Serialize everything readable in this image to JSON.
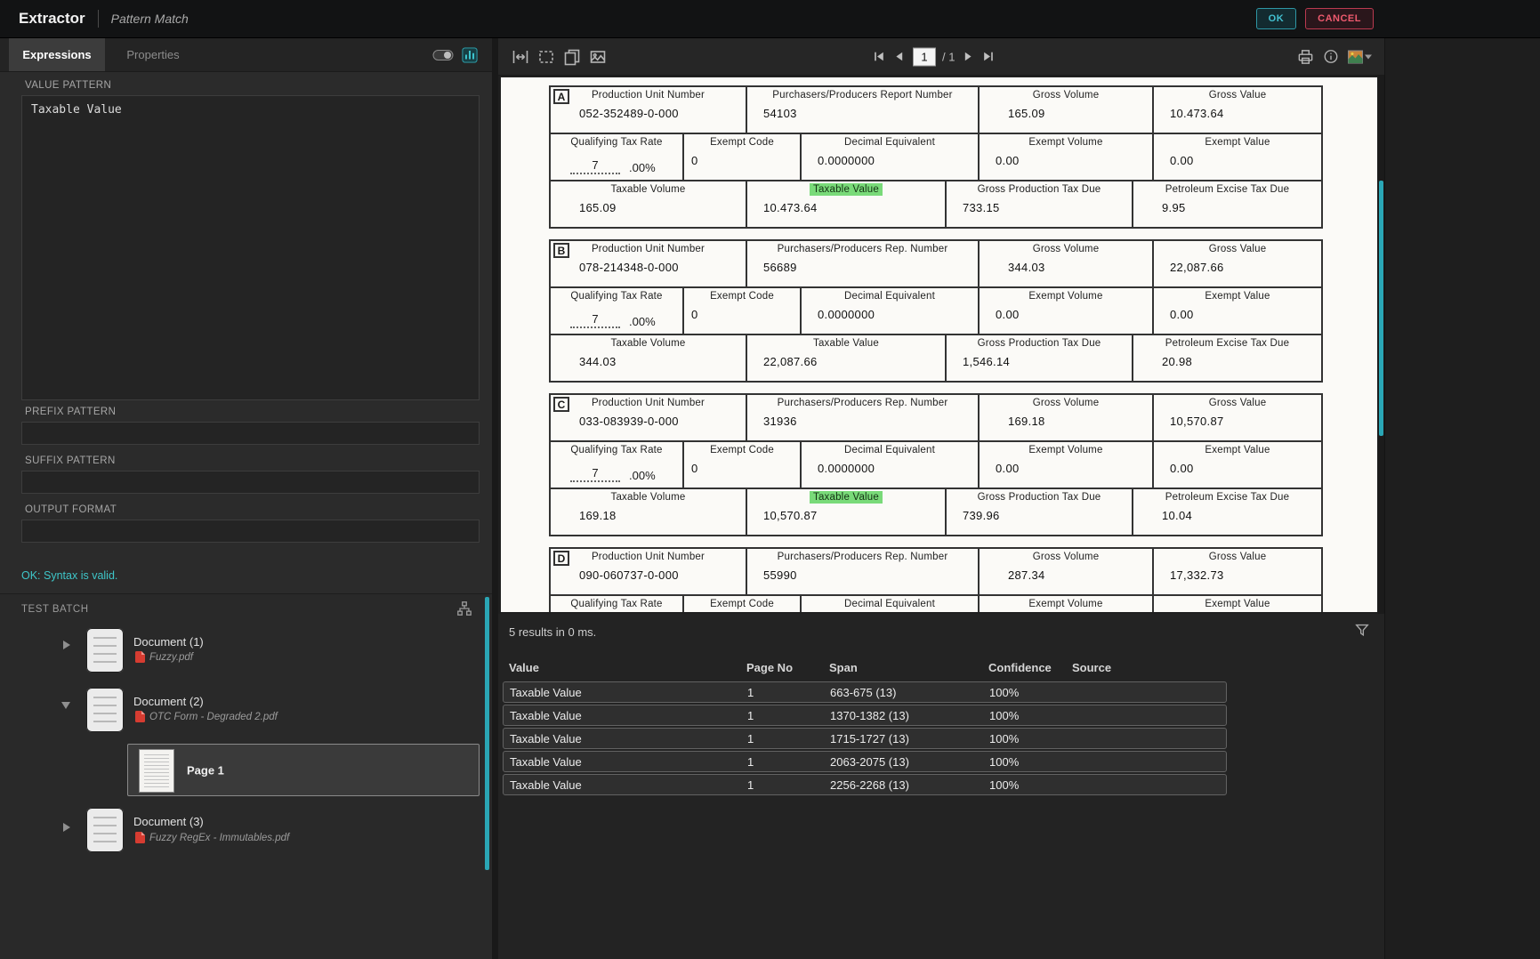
{
  "titlebar": {
    "title": "Extractor",
    "subtitle": "Pattern Match",
    "ok": "OK",
    "cancel": "CANCEL"
  },
  "panel": {
    "tab_expressions": "Expressions",
    "tab_properties": "Properties",
    "value_pattern_label": "VALUE PATTERN",
    "value_pattern_text": "Taxable Value",
    "prefix_pattern_label": "PREFIX PATTERN",
    "prefix_pattern_value": "",
    "suffix_pattern_label": "SUFFIX PATTERN",
    "suffix_pattern_value": "",
    "output_format_label": "OUTPUT FORMAT",
    "output_format_value": "",
    "status": "OK: Syntax is valid.",
    "test_batch_label": "TEST BATCH",
    "documents": [
      {
        "name": "Document (1)",
        "file": "Fuzzy.pdf"
      },
      {
        "name": "Document (2)",
        "file": "OTC Form - Degraded 2.pdf",
        "page": "Page 1"
      },
      {
        "name": "Document (3)",
        "file": "Fuzzy RegEx - Immutables.pdf"
      }
    ]
  },
  "viewer": {
    "page_value": "1",
    "page_total": "/ 1"
  },
  "form": {
    "sections": [
      {
        "letter": "A",
        "r1l": [
          "Production Unit Number",
          "Purchasers/Producers Report Number",
          "Gross Volume",
          "Gross Value"
        ],
        "r1v": [
          "052-352489-0-000",
          "54103",
          "165.09",
          "10.473.64"
        ],
        "r2l": [
          "Qualifying Tax Rate",
          "Exempt Code",
          "Decimal Equivalent",
          "Exempt Volume",
          "Exempt Value"
        ],
        "rate": "7",
        "rate_pct": ".00%",
        "r2v": [
          "0",
          "0.0000000",
          "0.00",
          "0.00"
        ],
        "r3l": [
          "Taxable Volume",
          "Taxable Value",
          "Gross Production Tax Due",
          "Petroleum Excise Tax Due"
        ],
        "r3v": [
          "165.09",
          "10.473.64",
          "733.15",
          "9.95"
        ],
        "taxable_value_highlighted": true
      },
      {
        "letter": "B",
        "r1l": [
          "Production Unit Number",
          "Purchasers/Producers Rep. Number",
          "Gross Volume",
          "Gross Value"
        ],
        "r1v": [
          "078-214348-0-000",
          "56689",
          "344.03",
          "22,087.66"
        ],
        "r2l": [
          "Qualifying Tax Rate",
          "Exempt Code",
          "Decimal Equivalent",
          "Exempt Volume",
          "Exempt Value"
        ],
        "rate": "7",
        "rate_pct": ".00%",
        "r2v": [
          "0",
          "0.0000000",
          "0.00",
          "0.00"
        ],
        "r3l": [
          "Taxable Volume",
          "Taxable Value",
          "Gross Production Tax Due",
          "Petroleum Excise Tax Due"
        ],
        "r3v": [
          "344.03",
          "22,087.66",
          "1,546.14",
          "20.98"
        ],
        "taxable_value_highlighted": false
      },
      {
        "letter": "C",
        "r1l": [
          "Production Unit Number",
          "Purchasers/Producers Rep. Number",
          "Gross Volume",
          "Gross Value"
        ],
        "r1v": [
          "033-083939-0-000",
          "31936",
          "169.18",
          "10,570.87"
        ],
        "r2l": [
          "Qualifying Tax Rate",
          "Exempt Code",
          "Decimal Equivalent",
          "Exempt Volume",
          "Exempt Value"
        ],
        "rate": "7",
        "rate_pct": ".00%",
        "r2v": [
          "0",
          "0.0000000",
          "0.00",
          "0.00"
        ],
        "r3l": [
          "Taxable Volume",
          "Taxable Value",
          "Gross Production Tax Due",
          "Petroleum Excise Tax Due"
        ],
        "r3v": [
          "169.18",
          "10,570.87",
          "739.96",
          "10.04"
        ],
        "taxable_value_highlighted": true
      },
      {
        "letter": "D",
        "r1l": [
          "Production Unit Number",
          "Purchasers/Producers Rep. Number",
          "Gross Volume",
          "Gross Value"
        ],
        "r1v": [
          "090-060737-0-000",
          "55990",
          "287.34",
          "17,332.73"
        ],
        "r2l": [
          "Qualifying Tax Rate",
          "Exempt Code",
          "Decimal Equivalent",
          "Exempt Volume",
          "Exempt Value"
        ],
        "rate": "",
        "rate_pct": "",
        "r2v": [
          "",
          "",
          "",
          ""
        ]
      }
    ]
  },
  "results": {
    "summary": "5 results in 0 ms.",
    "headers": [
      "Value",
      "Page No",
      "Span",
      "Confidence",
      "Source"
    ],
    "rows": [
      {
        "value": "Taxable Value",
        "page": "1",
        "span": "663-675 (13)",
        "confidence": "100%",
        "source": ""
      },
      {
        "value": "Taxable Value",
        "page": "1",
        "span": "1370-1382 (13)",
        "confidence": "100%",
        "source": ""
      },
      {
        "value": "Taxable Value",
        "page": "1",
        "span": "1715-1727 (13)",
        "confidence": "100%",
        "source": ""
      },
      {
        "value": "Taxable Value",
        "page": "1",
        "span": "2063-2075 (13)",
        "confidence": "100%",
        "source": ""
      },
      {
        "value": "Taxable Value",
        "page": "1",
        "span": "2256-2268 (13)",
        "confidence": "100%",
        "source": ""
      }
    ]
  },
  "icons": {
    "toolbar_left": [
      "fit-width",
      "marquee-select",
      "pages-view",
      "image-view"
    ],
    "toolbar_right": [
      "printer",
      "info",
      "image-options"
    ],
    "tab_icons": [
      "toggle",
      "statistics"
    ],
    "other": [
      "filter-funnel",
      "batch-tree",
      "expand-arrow",
      "collapse-arrow",
      "pdf"
    ]
  },
  "colors": {
    "accent_teal": "#2aa5b4",
    "status_teal": "#3ec6c9",
    "ok_teal": "#43c2d2",
    "cancel_red": "#ee5a6e",
    "match_green": "#79da79"
  }
}
